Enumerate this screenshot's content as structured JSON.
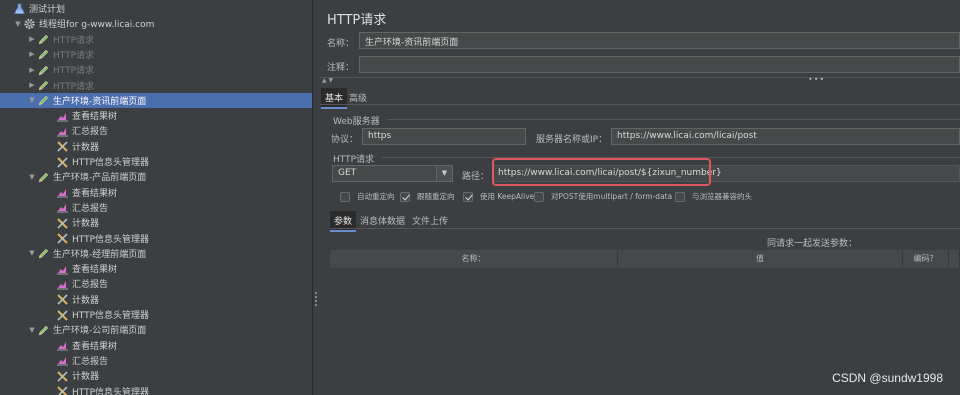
{
  "tree": {
    "items": [
      {
        "label": "测试计划",
        "icon": "flask-icon",
        "indent": 0,
        "arrow": "",
        "dim": false,
        "sel": false
      },
      {
        "label": "线程组for g-www.licai.com",
        "icon": "gear-icon",
        "indent": 1,
        "arrow": "▼",
        "dim": false,
        "sel": false
      },
      {
        "label": "HTTP请求",
        "icon": "pencil-icon",
        "indent": 2,
        "arrow": "▶",
        "dim": true,
        "sel": false
      },
      {
        "label": "HTTP请求",
        "icon": "pencil-icon",
        "indent": 2,
        "arrow": "▶",
        "dim": true,
        "sel": false
      },
      {
        "label": "HTTP请求",
        "icon": "pencil-icon",
        "indent": 2,
        "arrow": "▶",
        "dim": true,
        "sel": false
      },
      {
        "label": "HTTP请求",
        "icon": "pencil-icon",
        "indent": 2,
        "arrow": "▶",
        "dim": true,
        "sel": false
      },
      {
        "label": "生产环境-资讯前端页面",
        "icon": "pencil-icon",
        "indent": 2,
        "arrow": "▼",
        "dim": false,
        "sel": true
      },
      {
        "label": "查看结果树",
        "icon": "chart-icon",
        "indent": 3,
        "arrow": "",
        "dim": false,
        "sel": false
      },
      {
        "label": "汇总报告",
        "icon": "chart-icon",
        "indent": 3,
        "arrow": "",
        "dim": false,
        "sel": false
      },
      {
        "label": "计数器",
        "icon": "tools-icon",
        "indent": 3,
        "arrow": "",
        "dim": false,
        "sel": false
      },
      {
        "label": "HTTP信息头管理器",
        "icon": "tools-icon",
        "indent": 3,
        "arrow": "",
        "dim": false,
        "sel": false
      },
      {
        "label": "生产环境-产品前端页面",
        "icon": "pencil-icon",
        "indent": 2,
        "arrow": "▼",
        "dim": false,
        "sel": false
      },
      {
        "label": "查看结果树",
        "icon": "chart-icon",
        "indent": 3,
        "arrow": "",
        "dim": false,
        "sel": false
      },
      {
        "label": "汇总报告",
        "icon": "chart-icon",
        "indent": 3,
        "arrow": "",
        "dim": false,
        "sel": false
      },
      {
        "label": "计数器",
        "icon": "tools-icon",
        "indent": 3,
        "arrow": "",
        "dim": false,
        "sel": false
      },
      {
        "label": "HTTP信息头管理器",
        "icon": "tools-icon",
        "indent": 3,
        "arrow": "",
        "dim": false,
        "sel": false
      },
      {
        "label": "生产环境-经理前端页面",
        "icon": "pencil-icon",
        "indent": 2,
        "arrow": "▼",
        "dim": false,
        "sel": false
      },
      {
        "label": "查看结果树",
        "icon": "chart-icon",
        "indent": 3,
        "arrow": "",
        "dim": false,
        "sel": false
      },
      {
        "label": "汇总报告",
        "icon": "chart-icon",
        "indent": 3,
        "arrow": "",
        "dim": false,
        "sel": false
      },
      {
        "label": "计数器",
        "icon": "tools-icon",
        "indent": 3,
        "arrow": "",
        "dim": false,
        "sel": false
      },
      {
        "label": "HTTP信息头管理器",
        "icon": "tools-icon",
        "indent": 3,
        "arrow": "",
        "dim": false,
        "sel": false
      },
      {
        "label": "生产环境-公司前端页面",
        "icon": "pencil-icon",
        "indent": 2,
        "arrow": "▼",
        "dim": false,
        "sel": false
      },
      {
        "label": "查看结果树",
        "icon": "chart-icon",
        "indent": 3,
        "arrow": "",
        "dim": false,
        "sel": false
      },
      {
        "label": "汇总报告",
        "icon": "chart-icon",
        "indent": 3,
        "arrow": "",
        "dim": false,
        "sel": false
      },
      {
        "label": "计数器",
        "icon": "tools-icon",
        "indent": 3,
        "arrow": "",
        "dim": false,
        "sel": false
      },
      {
        "label": "HTTP信息头管理器",
        "icon": "tools-icon",
        "indent": 3,
        "arrow": "",
        "dim": false,
        "sel": false
      }
    ]
  },
  "panel": {
    "title": "HTTP请求",
    "name_label": "名称：",
    "name_value": "生产环境-资讯前端页面",
    "comment_label": "注释：",
    "comment_value": "",
    "tabs": {
      "basic": "基本",
      "advanced": "高级"
    },
    "web_server_title": "Web服务器",
    "protocol_label": "协议：",
    "protocol_value": "https",
    "server_label": "服务器名称或IP：",
    "server_value": "https://www.licai.com/licai/post",
    "http_request_title": "HTTP请求",
    "method_value": "GET",
    "path_label": "路径：",
    "path_value": "https://www.licai.com/licai/post/${zixun_number}",
    "checkboxes": [
      {
        "label": "自动重定向",
        "checked": false
      },
      {
        "label": "跟随重定向",
        "checked": true
      },
      {
        "label": "使用 KeepAlive",
        "checked": true
      },
      {
        "label": "对POST使用multipart / form-data",
        "checked": false
      },
      {
        "label": "与浏览器兼容的头",
        "checked": false
      }
    ],
    "subtabs": {
      "params": "参数",
      "body": "消息体数据",
      "files": "文件上传"
    },
    "send_params_title": "同请求一起发送参数：",
    "columns": {
      "name": "名称：",
      "value": "值",
      "encode": "编码？"
    }
  },
  "watermark": "CSDN @sundw1998",
  "colors": {
    "selection": "#4b6eaf",
    "highlight": "#e0555f",
    "background": "#3c3f41"
  }
}
